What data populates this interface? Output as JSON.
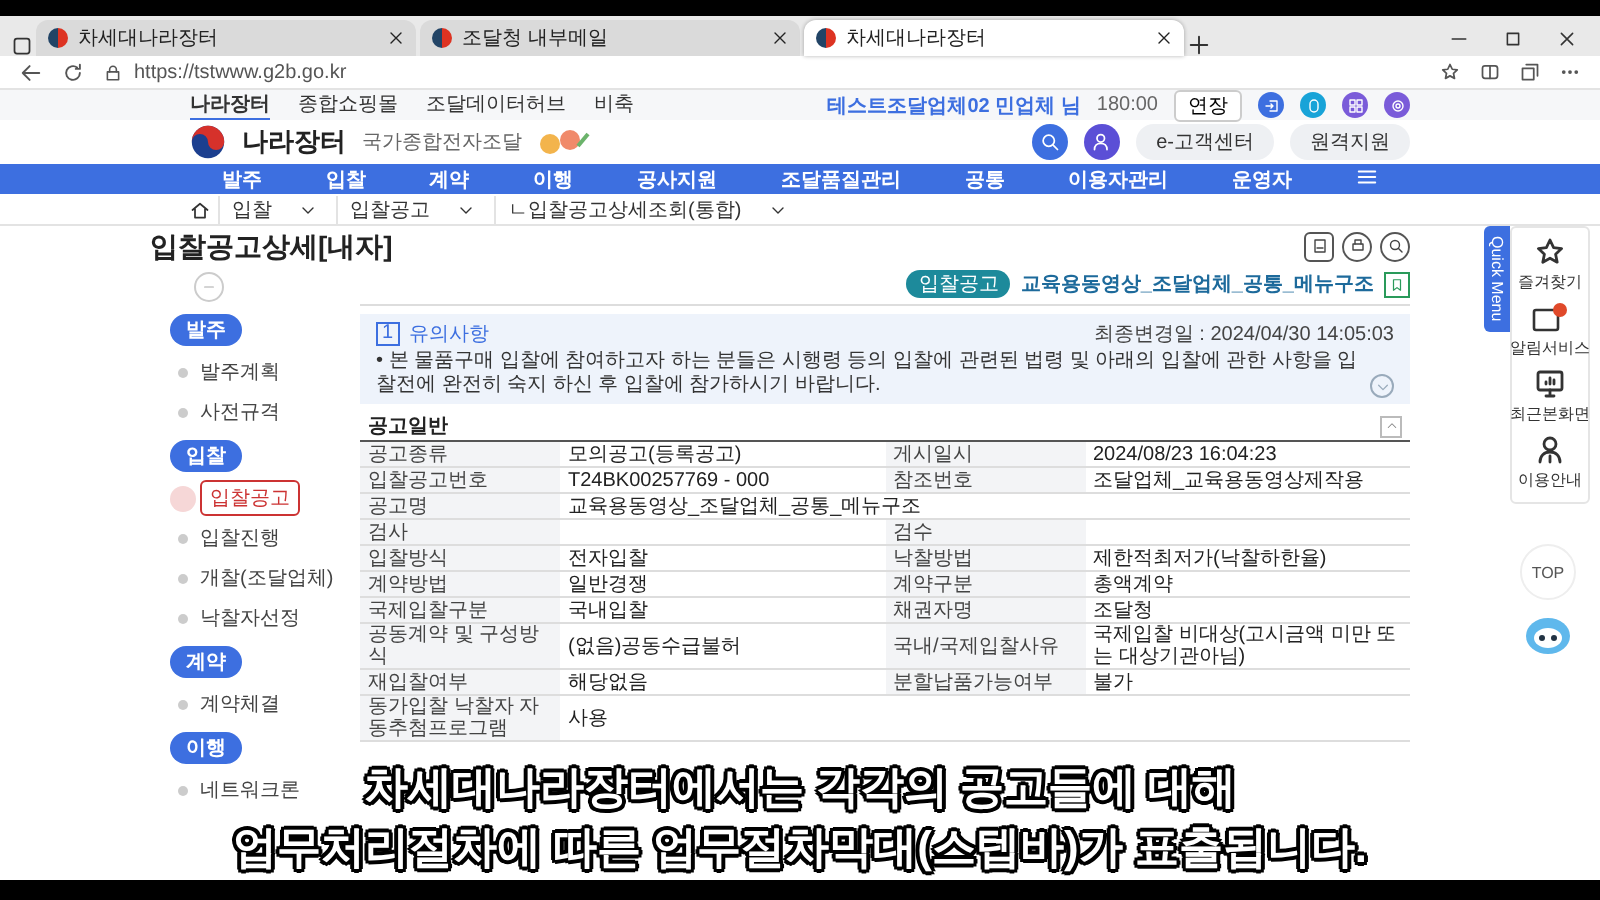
{
  "browser": {
    "tabs": [
      {
        "title": "차세대나라장터",
        "selected": false
      },
      {
        "title": "조달청 내부메일",
        "selected": false
      },
      {
        "title": "차세대나라장터",
        "selected": true
      }
    ],
    "url": "https://tstwww.g2b.go.kr"
  },
  "site_links": [
    {
      "label": "나라장터",
      "selected": true
    },
    {
      "label": "종합쇼핑몰",
      "selected": false
    },
    {
      "label": "조달데이터허브",
      "selected": false
    },
    {
      "label": "비축",
      "selected": false
    }
  ],
  "user": {
    "name": "테스트조달업체02 민업체 님",
    "session_time": "180:00",
    "extend_button": "연장"
  },
  "logo": {
    "name": "나라장터",
    "subtitle": "국가종합전자조달"
  },
  "header_buttons": [
    "e-고객센터",
    "원격지원"
  ],
  "nav": [
    "발주",
    "입찰",
    "계약",
    "이행",
    "공사지원",
    "조달품질관리",
    "공통",
    "이용자관리",
    "운영자"
  ],
  "breadcrumb": [
    "입찰",
    "입찰공고",
    "ㄴ입찰공고상세조회(통합)"
  ],
  "page_title": "입찰공고상세[내자]",
  "notice_tag": "입찰공고",
  "notice_title": "교육용동영상_조달업체_공통_메뉴구조",
  "caution": {
    "number": "1",
    "title": "유의사항",
    "updated": "최종변경일 : 2024/04/30 14:05:03",
    "text": "• 본 물품구매 입찰에 참여하고자 하는 분들은 시행령 등의 입찰에 관련된 법령 및 아래의 입찰에 관한 사항을 입찰전에 완전히 숙지 하신 후 입찰에 참가하시기 바랍니다."
  },
  "steps": [
    {
      "kind": "stage",
      "label": "발주"
    },
    {
      "kind": "step",
      "label": "발주계획",
      "selected": false
    },
    {
      "kind": "step",
      "label": "사전규격",
      "selected": false
    },
    {
      "kind": "stage",
      "label": "입찰"
    },
    {
      "kind": "step",
      "label": "입찰공고",
      "selected": true
    },
    {
      "kind": "step",
      "label": "입찰진행",
      "selected": false
    },
    {
      "kind": "step",
      "label": "개찰(조달업체)",
      "selected": false
    },
    {
      "kind": "step",
      "label": "낙찰자선정",
      "selected": false
    },
    {
      "kind": "stage",
      "label": "계약"
    },
    {
      "kind": "step",
      "label": "계약체결",
      "selected": false
    },
    {
      "kind": "stage",
      "label": "이행"
    },
    {
      "kind": "step",
      "label": "네트워크론",
      "selected": false
    }
  ],
  "section": {
    "title": "공고일반",
    "rows": [
      {
        "cells": [
          {
            "label": "공고종류",
            "value": "모의공고(등록공고)"
          },
          {
            "label": "게시일시",
            "value": "2024/08/23 16:04:23"
          }
        ]
      },
      {
        "cells": [
          {
            "label": "입찰공고번호",
            "value": "T24BK00257769 - 000"
          },
          {
            "label": "참조번호",
            "value": "조달업체_교육용동영상제작용"
          }
        ]
      },
      {
        "cells": [
          {
            "label": "공고명",
            "value": "교육용동영상_조달업체_공통_메뉴구조"
          }
        ]
      },
      {
        "cells": [
          {
            "label": "검사"
          },
          {
            "label": "검수"
          }
        ]
      },
      {
        "cells": [
          {
            "label": "입찰방식",
            "value": "전자입찰"
          },
          {
            "label": "낙찰방법",
            "value": "제한적최저가(낙찰하한율)"
          }
        ]
      },
      {
        "cells": [
          {
            "label": "계약방법",
            "value": "일반경쟁"
          },
          {
            "label": "계약구분",
            "value": "총액계약"
          }
        ]
      },
      {
        "cells": [
          {
            "label": "국제입찰구분",
            "value": "국내입찰"
          },
          {
            "label": "채권자명",
            "value": "조달청"
          }
        ]
      },
      {
        "cells": [
          {
            "label": "공동계약 및 구성방식",
            "value": "(없음)공동수급불허"
          },
          {
            "label": "국내/국제입찰사유",
            "value": "국제입찰 비대상(고시금액 미만 또는 대상기관아님)"
          }
        ]
      },
      {
        "cells": [
          {
            "label": "재입찰여부",
            "value": "해당없음"
          },
          {
            "label": "분할납품가능여부",
            "value": "불가"
          }
        ]
      },
      {
        "cells": [
          {
            "label": "동가입찰 낙찰자 자동추첨프로그램",
            "value": "사용"
          }
        ]
      }
    ]
  },
  "quick_menu": {
    "title": "Quick Menu",
    "items": [
      {
        "kind": "star",
        "label": "즐겨찾기"
      },
      {
        "kind": "alert",
        "label": "알림서비스"
      },
      {
        "kind": "monitor",
        "label": "최근본화면"
      },
      {
        "kind": "guide",
        "label": "이용안내"
      }
    ]
  },
  "top_button": "TOP",
  "subtitles": [
    "차세대나라장터에서는 각각의 공고들에 대해",
    "업무처리절차에 따른 업무절차막대(스텝바)가 표출됩니다."
  ]
}
